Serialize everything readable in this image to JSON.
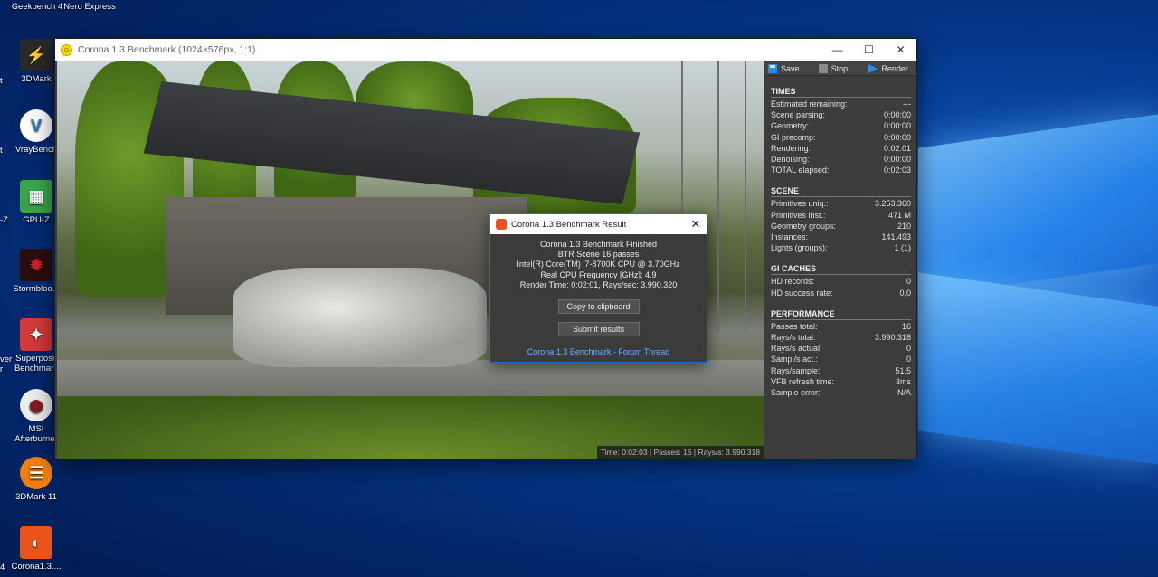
{
  "desktop": {
    "icons": [
      {
        "label": "Geekbench 4",
        "color": "#2a2a2a"
      },
      {
        "label": "Nero Express",
        "color": "#2a2a2a"
      },
      {
        "label": "3DMark",
        "color": "#ff8a00"
      },
      {
        "label": "VrayBench",
        "color": "#1b7fbf"
      },
      {
        "label": "GPU-Z",
        "color": "#3aa64a"
      },
      {
        "label": "Stormbloo...",
        "color": "#cc2222"
      },
      {
        "label": "Superposit Benchmark",
        "color": "#d33a3a"
      },
      {
        "label": "MSI Afterburner",
        "color": "#8a1a1a"
      },
      {
        "label": "3DMark 11",
        "color": "#f07f10"
      },
      {
        "label": "Corona1.3....",
        "color": "#e8541c"
      }
    ],
    "edge_labels": [
      "t",
      "t",
      "-Z",
      "ver",
      "r",
      "4"
    ]
  },
  "window": {
    "title": "Corona 1.3 Benchmark (1024×576px, 1:1)",
    "controls": {
      "minimize": "—",
      "maximize": "☐",
      "close": "✕"
    },
    "status_bar": "Time: 0:02:03 | Passes: 16 | Rays/s: 3.990.318"
  },
  "toolbar": {
    "save": "Save",
    "stop": "Stop",
    "render": "Render"
  },
  "panel": {
    "times": {
      "title": "TIMES",
      "rows": [
        {
          "label": "Estimated remaining:",
          "value": "---"
        },
        {
          "label": "Scene parsing:",
          "value": "0:00:00"
        },
        {
          "label": "Geometry:",
          "value": "0:00:00"
        },
        {
          "label": "GI precomp:",
          "value": "0:00:00"
        },
        {
          "label": "Rendering:",
          "value": "0:02:01"
        },
        {
          "label": "Denoising:",
          "value": "0:00:00"
        },
        {
          "label": "TOTAL elapsed:",
          "value": "0:02:03"
        }
      ]
    },
    "scene": {
      "title": "SCENE",
      "rows": [
        {
          "label": "Primitives uniq.:",
          "value": "3.253.360"
        },
        {
          "label": "Primitives inst.:",
          "value": "471 M"
        },
        {
          "label": "Geometry groups:",
          "value": "210"
        },
        {
          "label": "Instances:",
          "value": "141.493"
        },
        {
          "label": "Lights (groups):",
          "value": "1 (1)"
        }
      ]
    },
    "gi": {
      "title": "GI CACHES",
      "rows": [
        {
          "label": "HD records:",
          "value": "0"
        },
        {
          "label": "HD success rate:",
          "value": "0,0"
        }
      ]
    },
    "perf": {
      "title": "PERFORMANCE",
      "rows": [
        {
          "label": "Passes total:",
          "value": "16"
        },
        {
          "label": "Rays/s total:",
          "value": "3.990.318"
        },
        {
          "label": "Rays/s actual:",
          "value": "0"
        },
        {
          "label": "Sampl/s act.:",
          "value": "0"
        },
        {
          "label": "Rays/sample:",
          "value": "51,5"
        },
        {
          "label": "VFB refresh time:",
          "value": "3ms"
        },
        {
          "label": "Sample error:",
          "value": "N/A"
        }
      ]
    }
  },
  "dialog": {
    "title": "Corona 1.3 Benchmark Result",
    "close": "✕",
    "lines": [
      "Corona 1.3 Benchmark Finished",
      "BTR Scene 16 passes",
      "Intel(R) Core(TM) i7-8700K CPU @ 3.70GHz",
      "Real CPU Frequency [GHz]: 4.9",
      "Render Time: 0:02:01, Rays/sec: 3.990.320"
    ],
    "copy_button": "Copy to clipboard",
    "submit_button": "Submit results",
    "link": "Corona 1.3 Benchmark - Forum Thread"
  }
}
